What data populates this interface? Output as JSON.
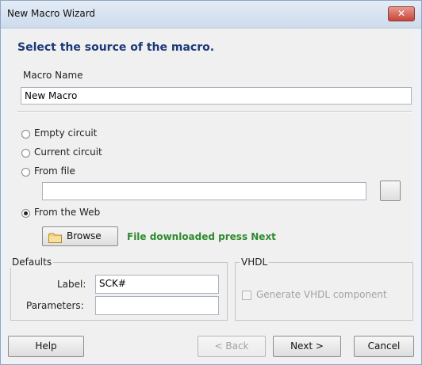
{
  "window": {
    "title": "New Macro Wizard",
    "close_glyph": "✕",
    "close_color": "#c7453a"
  },
  "header": {
    "text": "Select the source of the macro.",
    "color": "#1c3a7a"
  },
  "macro_name": {
    "label": "Macro Name",
    "value": "New Macro"
  },
  "source_options": [
    {
      "label": "Empty circuit",
      "selected": false
    },
    {
      "label": "Current circuit",
      "selected": false
    },
    {
      "label": "From file",
      "selected": false
    },
    {
      "label": "From the Web",
      "selected": true
    }
  ],
  "file_path": {
    "value": ""
  },
  "browse": {
    "label": "Browse",
    "icon": "folder-icon",
    "status": "File downloaded press Next",
    "status_color": "#2e8b2e"
  },
  "defaults": {
    "title": "Defaults",
    "label_caption": "Label:",
    "label_value": "SCK#",
    "params_caption": "Parameters:",
    "params_value": ""
  },
  "vhdl": {
    "title": "VHDL",
    "checkbox_label": "Generate VHDL component",
    "checked": false,
    "enabled": false
  },
  "buttons": {
    "help": "Help",
    "back": "< Back",
    "next": "Next >",
    "cancel": "Cancel"
  }
}
